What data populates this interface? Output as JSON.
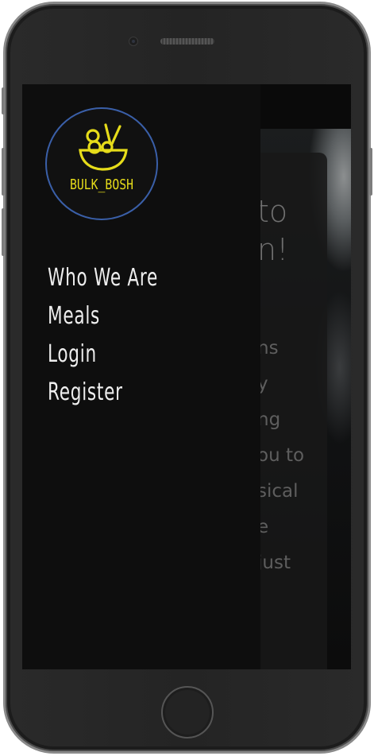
{
  "logo": {
    "text": "BULK_BOSH",
    "icon": "rice-bowl-icon",
    "accent": "#e6dc1a",
    "ring": "#3a5fa8"
  },
  "menu": {
    "items": [
      {
        "label": "Who We Are"
      },
      {
        "label": "Meals"
      },
      {
        "label": "Login"
      },
      {
        "label": "Register"
      }
    ]
  },
  "hero": {
    "title_lines": [
      "to",
      "n!"
    ],
    "text_lines": [
      "ns",
      "y",
      "ng",
      "ou to",
      "sical",
      "e",
      "just"
    ]
  }
}
